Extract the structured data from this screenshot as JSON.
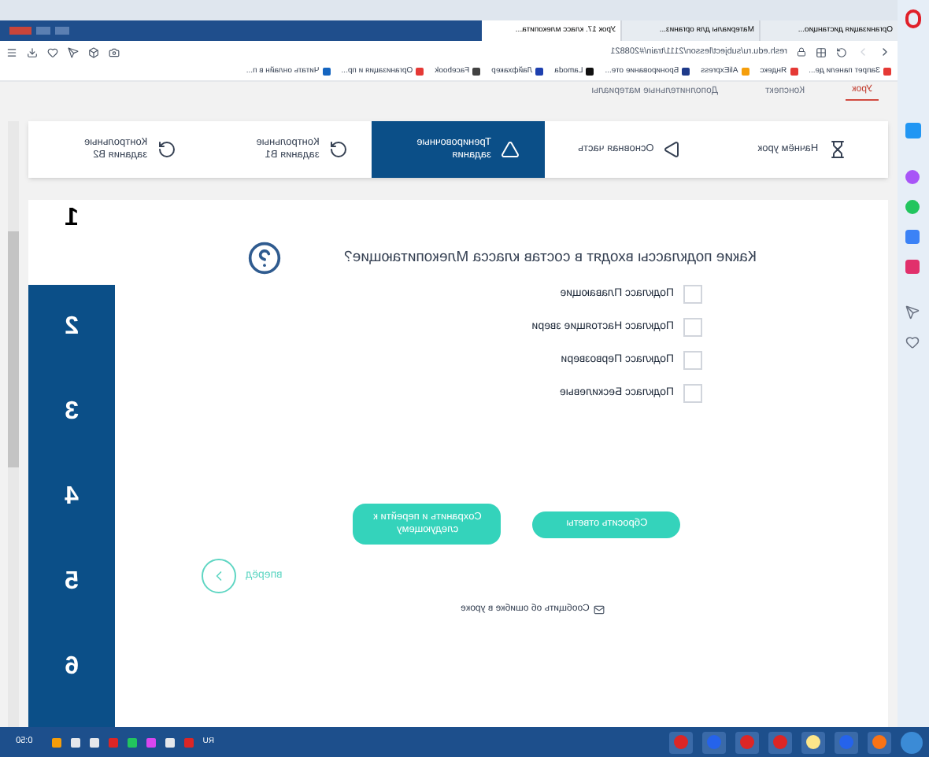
{
  "browser_tabs": [
    {
      "title": "Урок 17. класс млекопита...",
      "selected": true
    },
    {
      "title": "Материалы для организ...",
      "selected": false
    },
    {
      "title": "Организация дистанцио...",
      "selected": false
    }
  ],
  "address": "resh.edu.ru/subject/lesson/2111/train/#208821",
  "bookmarks": [
    "Читать онлайн в п...",
    "Организация и пр...",
    "Facebook",
    "Лайфхакер",
    "Lamoda",
    "Бронирование оте...",
    "AliExpress",
    "Яндекс",
    "Запрет панели де..."
  ],
  "page_tabs": [
    {
      "label": "Дополнительные материалы",
      "selected": false
    },
    {
      "label": "Конспект",
      "selected": false
    },
    {
      "label": "Урок",
      "selected": true
    }
  ],
  "lesson_nav": [
    {
      "label": "Контрольные задания В2",
      "kind": "control",
      "selected": false
    },
    {
      "label": "Контрольные задания В1",
      "kind": "control",
      "selected": false
    },
    {
      "label": "Тренировочные задания",
      "kind": "training",
      "selected": true
    },
    {
      "label": "Основная часть",
      "kind": "main",
      "selected": false
    },
    {
      "label": "Начнём урок",
      "kind": "start",
      "selected": false
    }
  ],
  "question": "Какие подклассы входят в состав класса Млекопитающие?",
  "options": [
    {
      "label": "Подкласс Плавающие",
      "checked": false
    },
    {
      "label": "Подкласс Настоящие звери",
      "checked": false
    },
    {
      "label": "Подкласс Первозвери",
      "checked": false
    },
    {
      "label": "Подкласс Бескилевые",
      "checked": false
    }
  ],
  "buttons": [
    "Сохранить и перейти к следующему",
    "Сбросить ответы"
  ],
  "next_link": "вперёд",
  "report_link": "Сообщить об ошибке в уроке",
  "task_numbers": [
    {
      "label": "1",
      "selected": true
    },
    {
      "label": "2",
      "selected": false
    },
    {
      "label": "3",
      "selected": false
    },
    {
      "label": "4",
      "selected": false
    },
    {
      "label": "5",
      "selected": false
    },
    {
      "label": "6",
      "selected": false
    }
  ],
  "taskbar": {
    "language": "RU",
    "time": "0:50"
  }
}
